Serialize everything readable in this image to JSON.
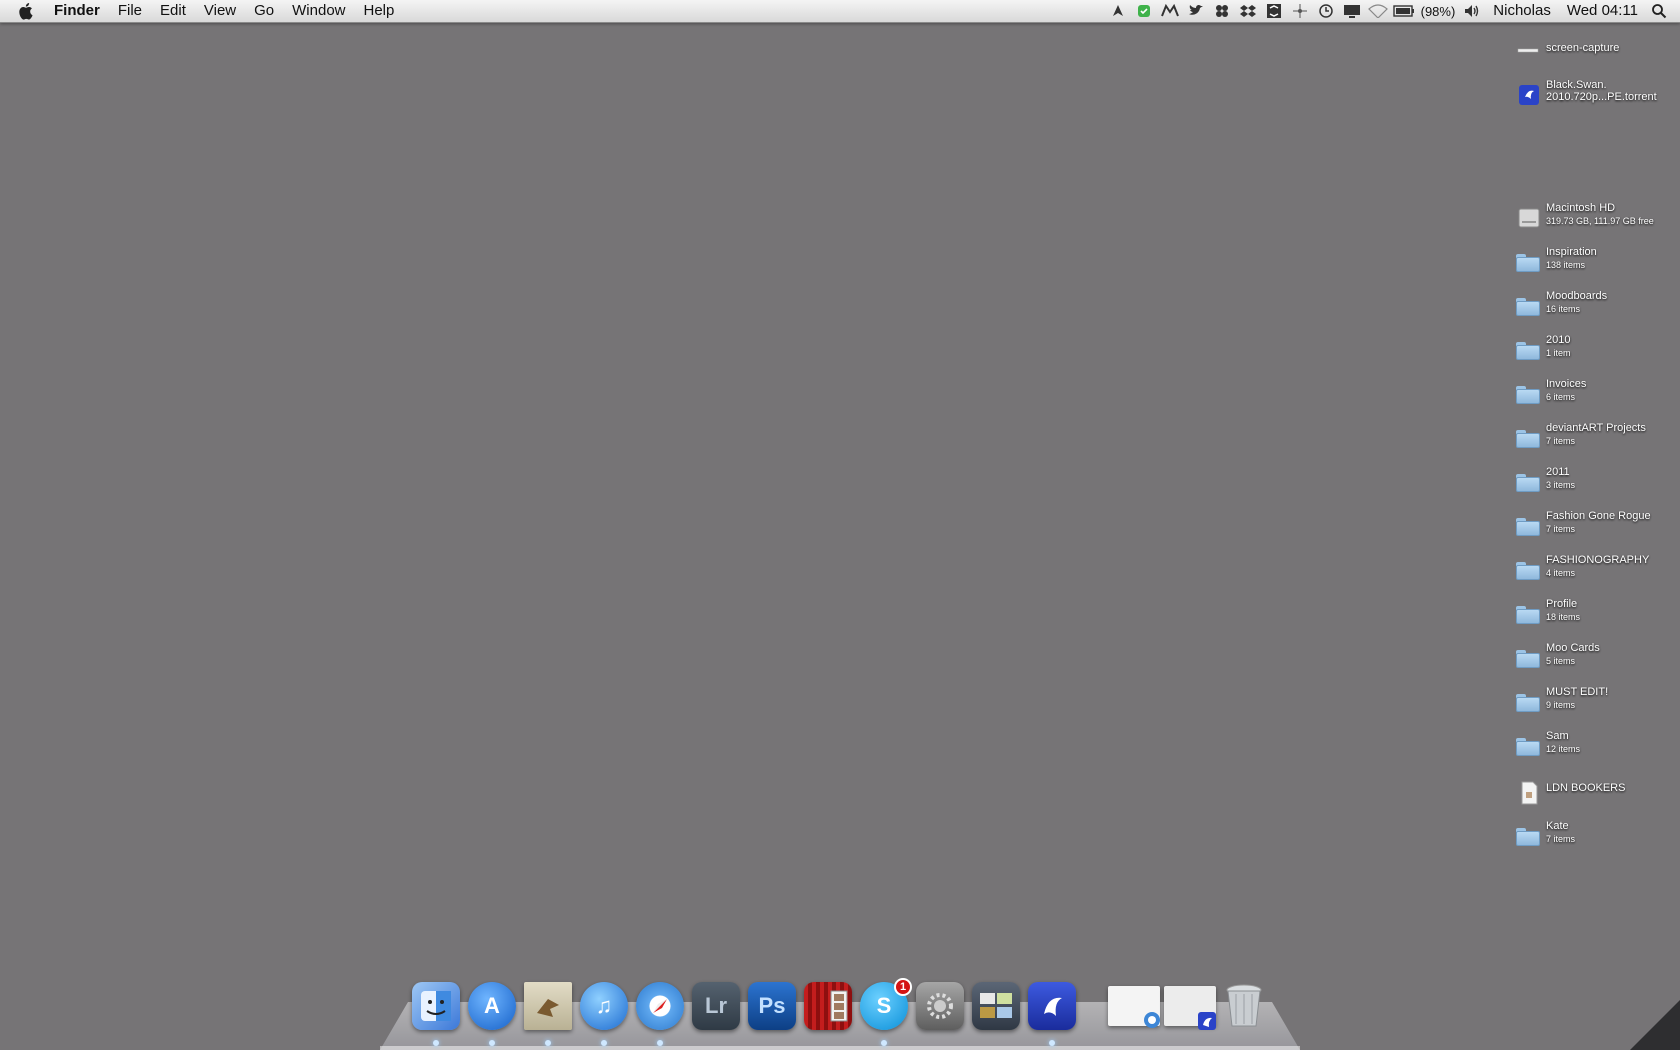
{
  "menubar": {
    "app_name": "Finder",
    "menus": [
      "File",
      "Edit",
      "View",
      "Go",
      "Window",
      "Help"
    ],
    "status_icons": [
      "growl-icon",
      "evernote-icon",
      "bluetooth-like-icon",
      "twitter-bird-icon",
      "cloud-app-icon",
      "dropbox-icon",
      "caffeine-icon",
      "activity-icon",
      "timemachine-icon",
      "display-icon",
      "wifi-icon",
      "battery-icon",
      "volume-icon"
    ],
    "battery_percent": "(98%)",
    "user": "Nicholas",
    "clock": "Wed 04:11"
  },
  "desktop": {
    "items": [
      {
        "name": "screen-capture",
        "sub": "",
        "icon": "screen-capture-icon"
      },
      {
        "name": "Black.Swan.",
        "name2": "2010.720p...PE.torrent",
        "sub": "",
        "icon": "torrent-file-icon"
      },
      {
        "name": "Macintosh HD",
        "sub": "319.73 GB, 111.97 GB free",
        "icon": "hard-drive-icon"
      },
      {
        "name": "Inspiration",
        "sub": "138 items",
        "icon": "folder-icon"
      },
      {
        "name": "Moodboards",
        "sub": "16 items",
        "icon": "folder-icon"
      },
      {
        "name": "2010",
        "sub": "1 item",
        "icon": "folder-icon"
      },
      {
        "name": "Invoices",
        "sub": "6 items",
        "icon": "folder-icon"
      },
      {
        "name": "deviantART Projects",
        "sub": "7 items",
        "icon": "folder-icon"
      },
      {
        "name": "2011",
        "sub": "3 items",
        "icon": "folder-icon"
      },
      {
        "name": "Fashion Gone Rogue",
        "sub": "7 items",
        "icon": "folder-icon"
      },
      {
        "name": "FASHIONOGRAPHY",
        "sub": "4 items",
        "icon": "folder-icon"
      },
      {
        "name": "Profile",
        "sub": "18 items",
        "icon": "folder-icon"
      },
      {
        "name": "Moo Cards",
        "sub": "5 items",
        "icon": "folder-icon"
      },
      {
        "name": "MUST EDIT!",
        "sub": "9 items",
        "icon": "folder-icon"
      },
      {
        "name": "Sam",
        "sub": "12 items",
        "icon": "folder-icon"
      },
      {
        "name": "LDN BOOKERS",
        "sub": "",
        "icon": "document-icon"
      },
      {
        "name": "Kate",
        "sub": "7 items",
        "icon": "folder-icon"
      }
    ]
  },
  "dock": {
    "apps": [
      {
        "icon": "finder-icon",
        "label": "",
        "color": "#5a8fe0"
      },
      {
        "icon": "app-store-icon",
        "label": "A",
        "color": "#2f7ee0"
      },
      {
        "icon": "mail-icon",
        "label": "",
        "color": "#c9c2a8"
      },
      {
        "icon": "itunes-icon",
        "label": "♫",
        "color": "#3a8ad6"
      },
      {
        "icon": "safari-icon",
        "label": "",
        "color": "#4a9be0"
      },
      {
        "icon": "lightroom-icon",
        "label": "Lr",
        "color": "#3b4a5a"
      },
      {
        "icon": "photoshop-icon",
        "label": "Ps",
        "color": "#1a5aa8"
      },
      {
        "icon": "photo-booth-icon",
        "label": "",
        "color": "#b31919"
      },
      {
        "icon": "skype-icon",
        "label": "S",
        "color": "#1ea5e6",
        "badge": "1"
      },
      {
        "icon": "system-preferences-icon",
        "label": "",
        "color": "#8c8c8c"
      },
      {
        "icon": "mission-control-icon",
        "label": "",
        "color": "#4a5462"
      },
      {
        "icon": "transmission-icon",
        "label": "",
        "color": "#2a43c8"
      },
      {
        "icon": "minimized-safari-window-icon",
        "label": "",
        "color": "#f2f2f2"
      },
      {
        "icon": "minimized-torrent-window-icon",
        "label": "",
        "color": "#e8e8e8"
      },
      {
        "icon": "trash-icon",
        "label": "",
        "color": "#b8bcc0"
      }
    ]
  }
}
